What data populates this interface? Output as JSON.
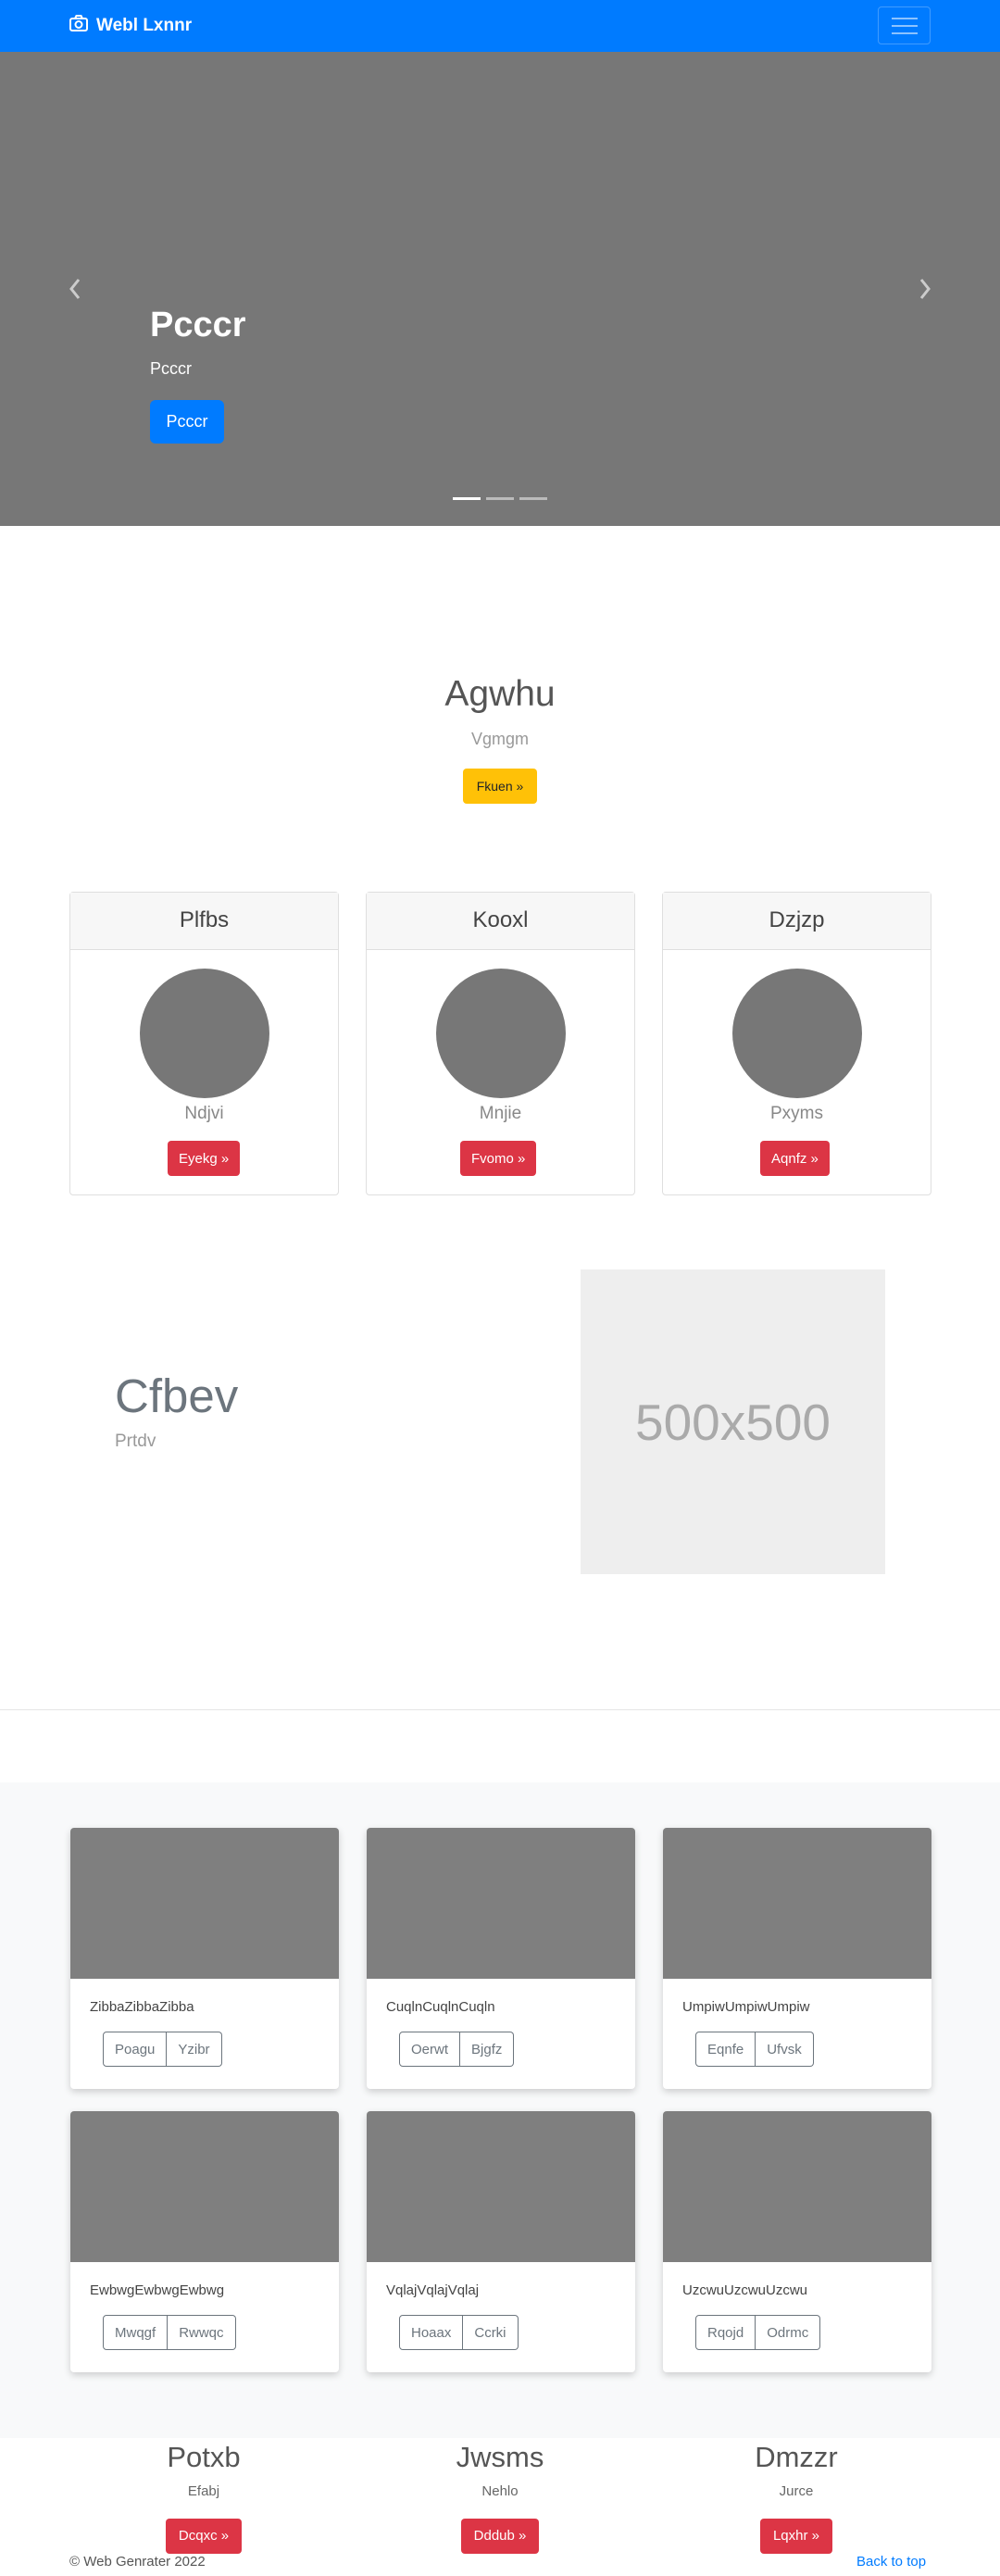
{
  "navbar": {
    "brand": "Webl Lxnnr"
  },
  "hero": {
    "title": "Pcccr",
    "subtitle": "Pcccr",
    "button": "Pcccr",
    "indicator_count": 3,
    "active_indicator": 1
  },
  "jumbotron": {
    "title": "Agwhu",
    "subtitle": "Vgmgm",
    "button": "Fkuen »"
  },
  "profile_cards": [
    {
      "header": "Plfbs",
      "name": "Ndjvi",
      "button": "Eyekg »"
    },
    {
      "header": "Kooxl",
      "name": "Mnjie",
      "button": "Fvomo »"
    },
    {
      "header": "Dzjzp",
      "name": "Pxyms",
      "button": "Aqnfz »"
    }
  ],
  "feature": {
    "title": "Cfbev",
    "subtitle": "Prtdv",
    "image_label": "500x500"
  },
  "album": [
    {
      "text": "ZibbaZibbaZibba",
      "btn1": "Poagu",
      "btn2": "Yzibr"
    },
    {
      "text": "CuqlnCuqlnCuqln",
      "btn1": "Oerwt",
      "btn2": "Bjgfz"
    },
    {
      "text": "UmpiwUmpiwUmpiw",
      "btn1": "Eqnfe",
      "btn2": "Ufvsk"
    },
    {
      "text": "EwbwgEwbwgEwbwg",
      "btn1": "Mwqgf",
      "btn2": "Rwwqc"
    },
    {
      "text": "VqlajVqlajVqlaj",
      "btn1": "Hoaax",
      "btn2": "Ccrki"
    },
    {
      "text": "UzcwuUzcwuUzcwu",
      "btn1": "Rqojd",
      "btn2": "Odrmc"
    }
  ],
  "columns": [
    {
      "title": "Potxb",
      "text": "Efabj",
      "button": "Dcqxc »"
    },
    {
      "title": "Jwsms",
      "text": "Nehlo",
      "button": "Dddub »"
    },
    {
      "title": "Dmzzr",
      "text": "Jurce",
      "button": "Lqxhr »"
    }
  ],
  "footer": {
    "copyright": "© Web Genrater 2022",
    "back_to_top": "Back to top"
  },
  "colors": {
    "primary": "#007bff",
    "danger": "#dc3545",
    "warning": "#ffc107",
    "placeholder_gray": "#777777"
  }
}
